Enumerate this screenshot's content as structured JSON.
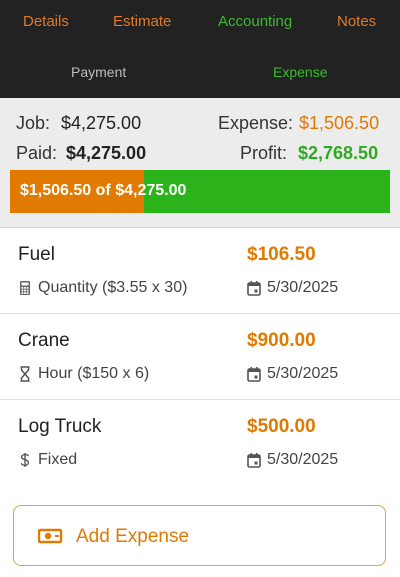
{
  "tabs": [
    {
      "label": "Details",
      "active": false
    },
    {
      "label": "Estimate",
      "active": false
    },
    {
      "label": "Accounting",
      "active": true
    },
    {
      "label": "Notes",
      "active": false
    }
  ],
  "subtabs": [
    {
      "label": "Payment",
      "active": false
    },
    {
      "label": "Expense",
      "active": true
    }
  ],
  "summary": {
    "job_label": "Job:",
    "job_value": "$4,275.00",
    "expense_label": "Expense:",
    "expense_value": "$1,506.50",
    "paid_label": "Paid:",
    "paid_value": "$4,275.00",
    "profit_label": "Profit:",
    "profit_value": "$2,768.50"
  },
  "progress": {
    "spent": "$1,506.50",
    "of_label": "of",
    "total": "$4,275.00",
    "fraction": 0.3524
  },
  "expenses": [
    {
      "name": "Fuel",
      "amount": "$106.50",
      "detail": "Quantity ($3.55 x 30)",
      "detail_icon": "calculator-icon",
      "date": "5/30/2025"
    },
    {
      "name": "Crane",
      "amount": "$900.00",
      "detail": "Hour ($150 x 6)",
      "detail_icon": "hourglass-icon",
      "date": "5/30/2025"
    },
    {
      "name": "Log Truck",
      "amount": "$500.00",
      "detail": "Fixed",
      "detail_icon": "dollar-icon",
      "date": "5/30/2025"
    }
  ],
  "add_button": {
    "label": "Add Expense",
    "icon": "cash-icon"
  },
  "colors": {
    "accent_orange": "#e07a00",
    "accent_green": "#2cb31c",
    "header_bg": "#222222"
  }
}
